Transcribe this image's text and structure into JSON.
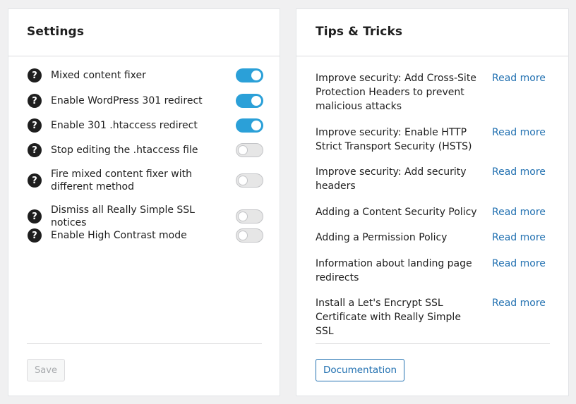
{
  "settings": {
    "title": "Settings",
    "items": [
      {
        "label": "Mixed content fixer",
        "on": true
      },
      {
        "label": "Enable WordPress 301 redirect",
        "on": true
      },
      {
        "label": "Enable 301 .htaccess redirect",
        "on": true
      },
      {
        "label": "Stop editing the .htaccess file",
        "on": false
      },
      {
        "label": "Fire mixed content fixer with different method",
        "on": false
      },
      {
        "label": "Dismiss all Really Simple SSL notices",
        "on": false
      },
      {
        "label": "Enable High Contrast mode",
        "on": false
      }
    ],
    "help_glyph": "?",
    "save_label": "Save"
  },
  "tips": {
    "title": "Tips & Tricks",
    "items": [
      {
        "text": "Improve security: Add Cross-Site Protection Headers to prevent malicious attacks",
        "link": "Read more"
      },
      {
        "text": "Improve security: Enable HTTP Strict Transport Security (HSTS)",
        "link": "Read more"
      },
      {
        "text": "Improve security: Add security headers",
        "link": "Read more"
      },
      {
        "text": "Adding a Content Security Policy",
        "link": "Read more"
      },
      {
        "text": "Adding a Permission Policy",
        "link": "Read more"
      },
      {
        "text": "Information about landing page redirects",
        "link": "Read more"
      },
      {
        "text": "Install a Let's Encrypt SSL Certificate with Really Simple SSL",
        "link": "Read more"
      }
    ],
    "documentation_label": "Documentation"
  },
  "colors": {
    "toggle_on": "#2ba0d8",
    "link": "#2271b1"
  }
}
